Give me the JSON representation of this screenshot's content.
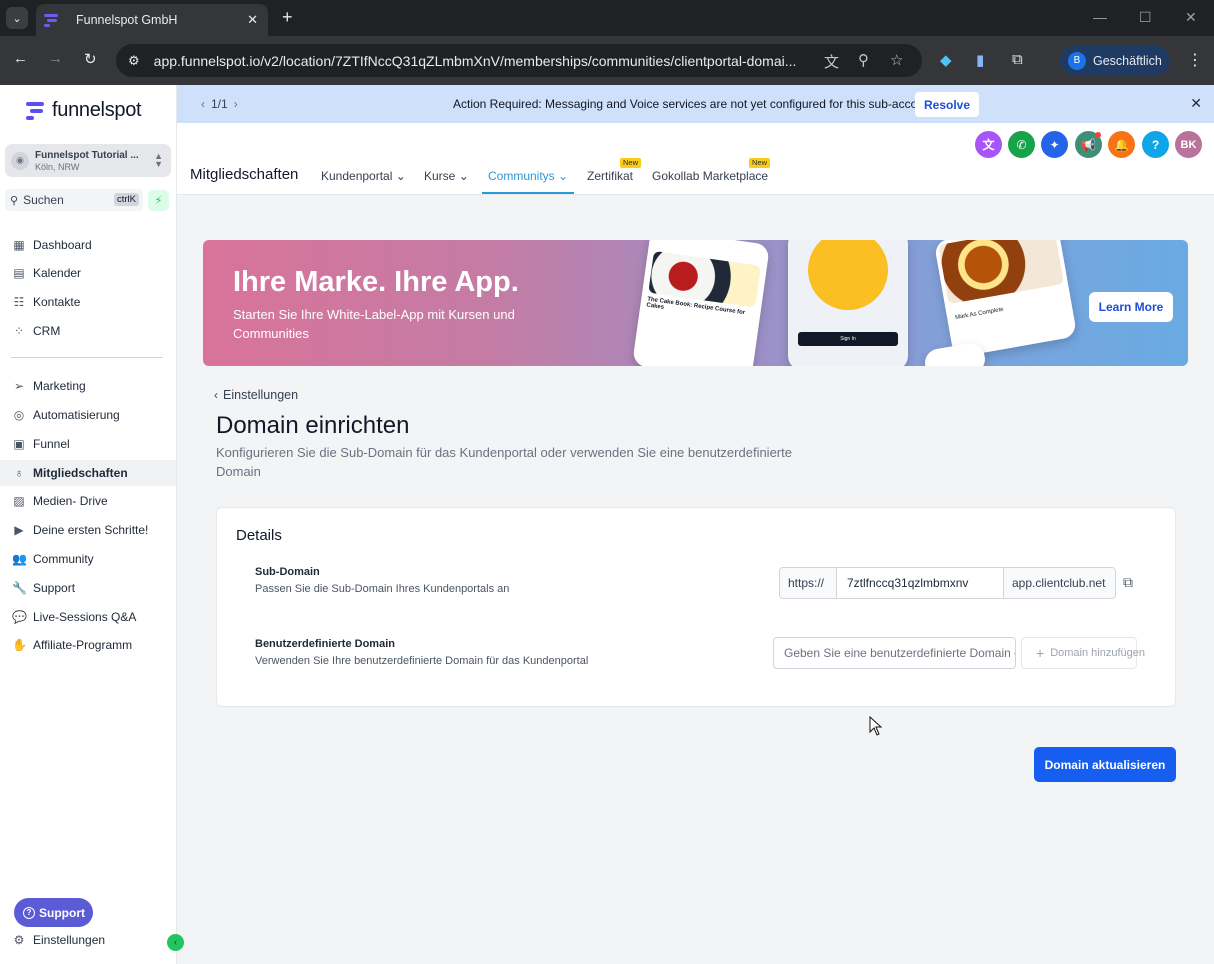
{
  "browser": {
    "tab_title": "Funnelspot GmbH",
    "url": "app.funnelspot.io/v2/location/7ZTIfNccQ31qZLmbmXnV/memberships/communities/clientportal-domai...",
    "profile_initial": "B",
    "profile_label": "Geschäftlich"
  },
  "sidebar": {
    "brand": "funnelspot",
    "location_name": "Funnelspot Tutorial ...",
    "location_city": "Köln, NRW",
    "search_label": "Suchen",
    "search_shortcut": "ctrlK",
    "items_top": [
      {
        "label": "Dashboard",
        "icon": "grid-icon"
      },
      {
        "label": "Kalender",
        "icon": "calendar-icon"
      },
      {
        "label": "Kontakte",
        "icon": "contacts-icon"
      },
      {
        "label": "CRM",
        "icon": "crm-icon"
      }
    ],
    "items_bottom": [
      {
        "label": "Marketing",
        "icon": "send-icon"
      },
      {
        "label": "Automatisierung",
        "icon": "automation-icon"
      },
      {
        "label": "Funnel",
        "icon": "funnel-icon"
      },
      {
        "label": "Mitgliedschaften",
        "icon": "award-icon",
        "active": true
      },
      {
        "label": "Medien- Drive",
        "icon": "image-icon"
      },
      {
        "label": "Deine ersten Schritte!",
        "icon": "play-icon"
      },
      {
        "label": "Community",
        "icon": "users-icon"
      },
      {
        "label": "Support",
        "icon": "wrench-icon"
      },
      {
        "label": "Live-Sessions Q&A",
        "icon": "chat-icon"
      },
      {
        "label": "Affiliate-Programm",
        "icon": "hand-coin-icon"
      }
    ],
    "support_button": "Support",
    "settings": "Einstellungen"
  },
  "banner": {
    "pager": "1/1",
    "message": "Action Required: Messaging and Voice services are not yet configured for this sub-account!",
    "resolve": "Resolve"
  },
  "header": {
    "title": "Mitgliedschaften",
    "avatar": "BK",
    "tabs": [
      {
        "label": "Kundenportal",
        "dropdown": true
      },
      {
        "label": "Kurse",
        "dropdown": true
      },
      {
        "label": "Communitys",
        "dropdown": true,
        "active": true
      },
      {
        "label": "Zertifikat",
        "badge": "New"
      },
      {
        "label": "Gokollab Marketplace",
        "badge": "New"
      }
    ]
  },
  "hero": {
    "title": "Ihre Marke. Ihre App.",
    "subtitle": "Starten Sie Ihre White-Label-App mit Kursen und Communities",
    "learn_more": "Learn More",
    "phone1_caption": "The Cake Book: Recipe Course for Cakes",
    "phone2_button": "Sign In",
    "phone3_item": "Mark As Complete"
  },
  "page": {
    "back_label": "Einstellungen",
    "title": "Domain einrichten",
    "description": "Konfigurieren Sie die Sub-Domain für das Kundenportal oder verwenden Sie eine benutzerdefinierte Domain"
  },
  "details": {
    "title": "Details",
    "subdomain": {
      "label": "Sub-Domain",
      "help": "Passen Sie die Sub-Domain Ihres Kundenportals an",
      "prefix": "https://",
      "value": "7ztlfnccq31qzlmbmxnv",
      "suffix": "app.clientclub.net"
    },
    "custom": {
      "label": "Benutzerdefinierte Domain",
      "help": "Verwenden Sie Ihre benutzerdefinierte Domain für das Kundenportal",
      "placeholder": "Geben Sie eine benutzerdefinierte Domain ein",
      "add_label": "Domain hinzufügen"
    }
  },
  "actions": {
    "update": "Domain aktualisieren"
  },
  "colors": {
    "accent": "#155eef",
    "brand": "#5b4ef5",
    "active_tab": "#2a9ad6",
    "banner_bg": "#cfe0fb"
  }
}
